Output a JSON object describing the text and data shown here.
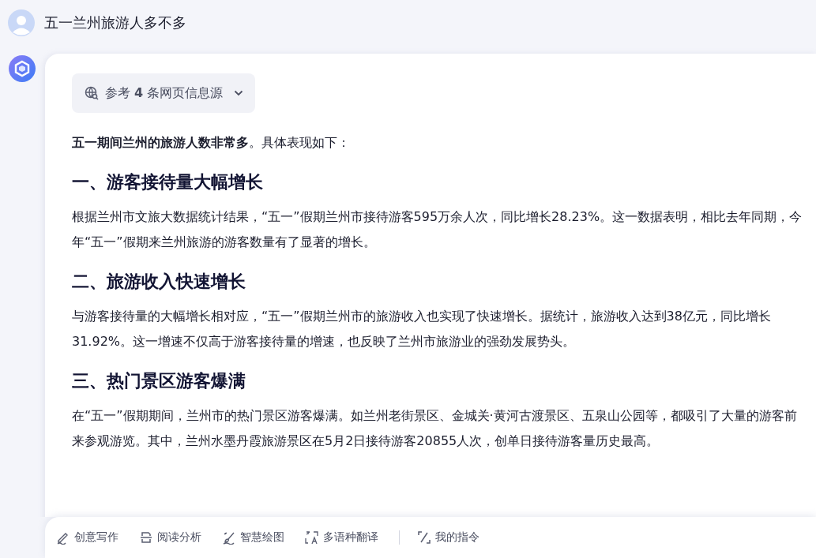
{
  "question": {
    "text": "五一兰州旅游人多不多"
  },
  "answer": {
    "sources": {
      "label": "参考 **4** 条网页信息源"
    },
    "intro": "**五一期间兰州的旅游人数非常多**。具体表现如下：",
    "sections": [
      {
        "heading": "一、游客接待量大幅增长",
        "body": "根据兰州市文旅大数据统计结果，“五一”假期兰州市接待游客595万余人次，同比增长28.23%。这一数据表明，相比去年同期，今年“五一”假期来兰州旅游的游客数量有了显著的增长。"
      },
      {
        "heading": "二、旅游收入快速增长",
        "body": "与游客接待量的大幅增长相对应，“五一”假期兰州市的旅游收入也实现了快速增长。据统计，旅游收入达到38亿元，同比增长31.92%。这一增速不仅高于游客接待量的增速，也反映了兰州市旅游业的强劲发展势头。"
      },
      {
        "heading": "三、热门景区游客爆满",
        "body": "在“五一”假期期间，兰州市的热门景区游客爆满。如兰州老街景区、金城关·黄河古渡景区、五泉山公园等，都吸引了大量的游客前来参观游览。其中，兰州水墨丹霞旅游景区在5月2日接待游客20855人次，创单日接待游客量历史最高。"
      }
    ]
  },
  "toolbar": {
    "tools": [
      "创意写作",
      "阅读分析",
      "智慧绘图",
      "多语种翻译"
    ],
    "my_commands": "我的指令"
  }
}
